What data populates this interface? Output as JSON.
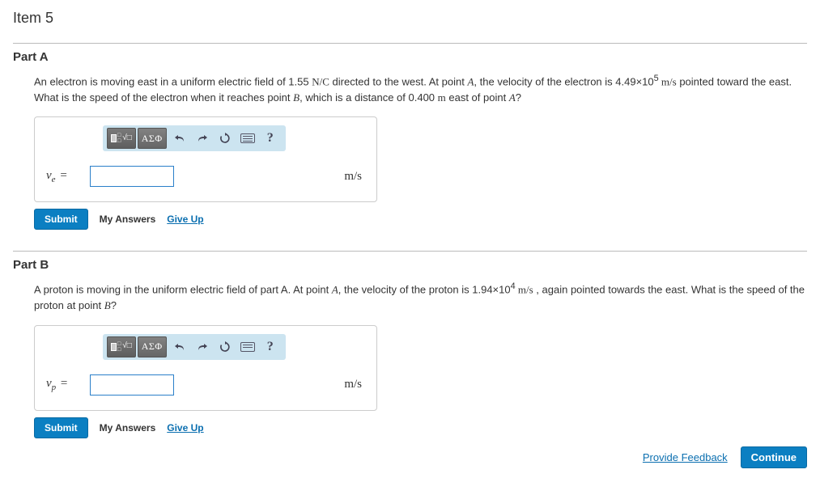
{
  "item_title": "Item 5",
  "partA": {
    "heading": "Part A",
    "question_pre": "An electron is moving east in a uniform electric field of 1.55 ",
    "q_unit1": "N/C",
    "q_mid1": " directed to the west. At point ",
    "q_pointA": "A",
    "q_mid2": ", the velocity of the electron is 4.49×10",
    "q_exp": "5",
    "q_unit2": " m/s",
    "q_mid3": " pointed toward the east. What is the speed of the electron when it reaches point ",
    "q_pointB": "B",
    "q_mid4": ", which is a distance of 0.400 ",
    "q_unit3": "m",
    "q_end": " east of point ",
    "q_pointA2": "A",
    "q_q": "?",
    "var": "v",
    "sub": "e",
    "eq": " = ",
    "unit": "m/s"
  },
  "partB": {
    "heading": "Part B",
    "question_pre": "A proton is moving in the uniform electric field of part A. At point ",
    "q_pointA": "A",
    "q_mid1": ", the velocity of the proton is 1.94×10",
    "q_exp": "4",
    "q_unit1": " m/s",
    "q_mid2": " , again pointed towards the east. What is the speed of the proton at point ",
    "q_pointB": "B",
    "q_q": "?",
    "var": "v",
    "sub": "p",
    "eq": " = ",
    "unit": "m/s"
  },
  "toolbar": {
    "greek": "ΑΣΦ",
    "help": "?"
  },
  "actions": {
    "submit": "Submit",
    "my_answers": "My Answers",
    "give_up": "Give Up"
  },
  "footer": {
    "feedback": "Provide Feedback",
    "continue": "Continue"
  }
}
